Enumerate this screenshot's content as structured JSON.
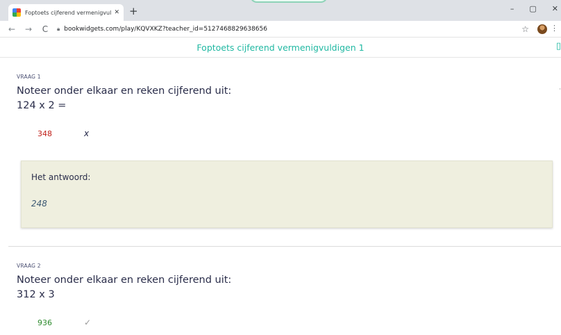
{
  "browser": {
    "tab_title": "Foptoets cijferend vermenigvuldi",
    "tab_close": "✕",
    "new_tab": "+",
    "url": "bookwidgets.com/play/KQVXKZ?teacher_id=5127468829638656",
    "window_controls": [
      "–",
      "▢",
      "✕"
    ],
    "menu_dots": "⋮",
    "star": "☆"
  },
  "page": {
    "title": "Foptoets cijferend vermenigvuldigen 1"
  },
  "questions": [
    {
      "label": "VRAAG 1",
      "prompt": "Noteer onder elkaar en reken cijferend uit:",
      "expression": "124 x 2 =",
      "given_answer": "348",
      "result_mark": "x",
      "correct": false,
      "feedback": {
        "label": "Het antwoord:",
        "value": "248"
      }
    },
    {
      "label": "VRAAG 2",
      "prompt": "Noteer onder elkaar en reken cijferend uit:",
      "expression": "312 x 3",
      "given_answer": "936",
      "result_mark": "✓",
      "correct": true
    }
  ],
  "colors": {
    "accent": "#20b8a2",
    "wrong": "#c0211b",
    "right": "#2e8b2e",
    "feedback_bg": "#efefdf"
  }
}
